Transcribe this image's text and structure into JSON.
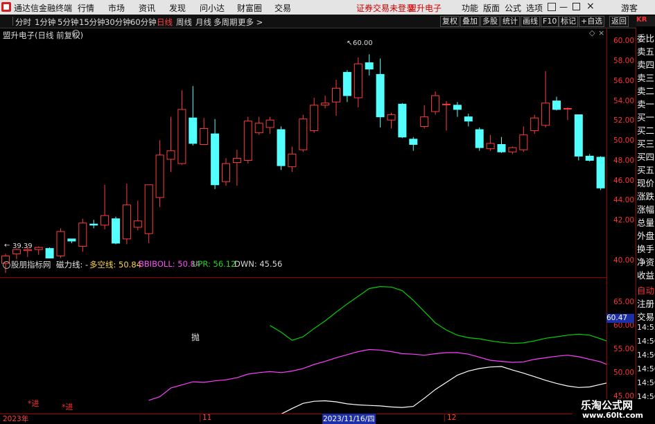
{
  "menu": {
    "app_title": "通达信金融终端",
    "items": [
      "行情",
      "市场",
      "资讯",
      "发现",
      "问小达",
      "财富圈",
      "交易"
    ],
    "notice": "证券交易未登录",
    "stock_name": "盟升电子",
    "right_items": [
      "功能",
      "版面",
      "公式",
      "选项"
    ],
    "guest": "游客"
  },
  "periods": [
    "分时",
    "1分钟",
    "5分钟",
    "15分钟",
    "30分钟",
    "60分钟",
    "日线",
    "周线",
    "月线",
    "多周期",
    "更多 >"
  ],
  "active_period": "日线",
  "toolbar_right": [
    "复权",
    "叠加",
    "多股",
    "统计",
    "画线",
    "F10",
    "标记",
    "+自选",
    "返回"
  ],
  "main_title": "盟升电子(日线 前复权)",
  "chart_data": [
    {
      "type": "candlestick",
      "title": "盟升电子(日线 前复权)",
      "yticks": [
        60,
        58,
        56,
        54,
        52,
        50,
        48,
        46,
        44,
        42,
        40
      ],
      "ytick_labels": [
        "60.00",
        "58.00",
        "56.00",
        "54.00",
        "52.00",
        "50.00",
        "48.00",
        "46.00",
        "44.00",
        "42.00",
        "40.00"
      ],
      "ylim": [
        39.0,
        62.5
      ],
      "annotations": {
        "high": "60.00",
        "low": "39.39"
      },
      "candles": [
        {
          "o": 40.3,
          "h": 41.2,
          "l": 39.4,
          "c": 41.0
        },
        {
          "o": 41.2,
          "h": 41.7,
          "l": 40.7,
          "c": 41.6
        },
        {
          "o": 41.5,
          "h": 41.9,
          "l": 40.9,
          "c": 41.6
        },
        {
          "o": 41.6,
          "h": 41.9,
          "l": 41.1,
          "c": 41.8
        },
        {
          "o": 41.7,
          "h": 41.8,
          "l": 40.8,
          "c": 40.8
        },
        {
          "o": 41.0,
          "h": 43.6,
          "l": 40.8,
          "c": 43.3
        },
        {
          "o": 42.6,
          "h": 42.6,
          "l": 42.2,
          "c": 42.4
        },
        {
          "o": 41.9,
          "h": 44.5,
          "l": 41.4,
          "c": 44.1
        },
        {
          "o": 44.0,
          "h": 44.4,
          "l": 43.6,
          "c": 43.9
        },
        {
          "o": 43.9,
          "h": 47.7,
          "l": 43.5,
          "c": 44.8
        },
        {
          "o": 44.5,
          "h": 44.7,
          "l": 42.1,
          "c": 42.2
        },
        {
          "o": 42.6,
          "h": 47.8,
          "l": 42.1,
          "c": 45.8
        },
        {
          "o": 43.7,
          "h": 46.2,
          "l": 43.4,
          "c": 44.3
        },
        {
          "o": 43.1,
          "h": 47.1,
          "l": 42.2,
          "c": 47.7
        },
        {
          "o": 46.5,
          "h": 51.9,
          "l": 45.6,
          "c": 50.5
        },
        {
          "o": 50.1,
          "h": 54.1,
          "l": 48.9,
          "c": 50.9
        },
        {
          "o": 49.7,
          "h": 56.6,
          "l": 49.6,
          "c": 54.8
        },
        {
          "o": 54.0,
          "h": 57.0,
          "l": 51.4,
          "c": 51.6
        },
        {
          "o": 51.5,
          "h": 54.0,
          "l": 51.5,
          "c": 53.0
        },
        {
          "o": 52.5,
          "h": 53.9,
          "l": 47.3,
          "c": 47.7
        },
        {
          "o": 48.0,
          "h": 50.2,
          "l": 47.6,
          "c": 49.7
        },
        {
          "o": 49.8,
          "h": 51.0,
          "l": 47.6,
          "c": 50.2
        },
        {
          "o": 50.0,
          "h": 54.1,
          "l": 49.7,
          "c": 53.7
        },
        {
          "o": 52.6,
          "h": 54.1,
          "l": 52.4,
          "c": 53.5
        },
        {
          "o": 53.1,
          "h": 54.1,
          "l": 52.5,
          "c": 53.8
        },
        {
          "o": 52.9,
          "h": 53.2,
          "l": 49.1,
          "c": 49.5
        },
        {
          "o": 49.4,
          "h": 51.3,
          "l": 48.9,
          "c": 50.6
        },
        {
          "o": 51.0,
          "h": 54.3,
          "l": 50.8,
          "c": 53.9
        },
        {
          "o": 52.8,
          "h": 55.9,
          "l": 52.6,
          "c": 55.2
        },
        {
          "o": 55.2,
          "h": 56.1,
          "l": 54.9,
          "c": 55.4
        },
        {
          "o": 55.5,
          "h": 57.6,
          "l": 54.2,
          "c": 56.8
        },
        {
          "o": 58.3,
          "h": 58.5,
          "l": 55.5,
          "c": 56.1
        },
        {
          "o": 55.9,
          "h": 59.7,
          "l": 55.0,
          "c": 59.1
        },
        {
          "o": 59.2,
          "h": 60.0,
          "l": 58.0,
          "c": 58.6
        },
        {
          "o": 58.1,
          "h": 59.6,
          "l": 53.1,
          "c": 54.1
        },
        {
          "o": 53.8,
          "h": 54.5,
          "l": 53.0,
          "c": 54.3
        },
        {
          "o": 55.3,
          "h": 55.4,
          "l": 52.1,
          "c": 52.2
        },
        {
          "o": 52.0,
          "h": 52.2,
          "l": 50.9,
          "c": 51.5
        },
        {
          "o": 53.2,
          "h": 55.2,
          "l": 53.0,
          "c": 54.1
        },
        {
          "o": 54.6,
          "h": 56.5,
          "l": 54.3,
          "c": 56.1
        },
        {
          "o": 55.3,
          "h": 55.6,
          "l": 52.8,
          "c": 55.3
        },
        {
          "o": 55.2,
          "h": 55.5,
          "l": 54.1,
          "c": 54.8
        },
        {
          "o": 54.1,
          "h": 54.4,
          "l": 53.2,
          "c": 53.7
        },
        {
          "o": 52.9,
          "h": 53.1,
          "l": 50.9,
          "c": 51.2
        },
        {
          "o": 51.1,
          "h": 52.4,
          "l": 50.9,
          "c": 51.6
        },
        {
          "o": 51.5,
          "h": 52.2,
          "l": 50.7,
          "c": 50.8
        },
        {
          "o": 50.8,
          "h": 51.3,
          "l": 50.6,
          "c": 51.2
        },
        {
          "o": 51.0,
          "h": 53.2,
          "l": 50.8,
          "c": 52.4
        },
        {
          "o": 52.8,
          "h": 54.3,
          "l": 52.5,
          "c": 54.0
        },
        {
          "o": 53.3,
          "h": 58.4,
          "l": 53.1,
          "c": 55.4
        },
        {
          "o": 55.6,
          "h": 56.0,
          "l": 54.7,
          "c": 54.8
        },
        {
          "o": 54.9,
          "h": 55.0,
          "l": 53.8,
          "c": 54.9
        },
        {
          "o": 54.3,
          "h": 54.3,
          "l": 50.0,
          "c": 50.4
        },
        {
          "o": 50.4,
          "h": 50.6,
          "l": 49.9,
          "c": 50.0
        },
        {
          "o": 50.3,
          "h": 50.4,
          "l": 47.2,
          "c": 47.4
        },
        {
          "o": 47.1,
          "h": 47.9,
          "l": 45.8,
          "c": 47.2
        }
      ]
    },
    {
      "type": "line",
      "title": "磁力线",
      "yticks": [
        65,
        60,
        55,
        50,
        45
      ],
      "ytick_labels": [
        "65.00",
        "60.00",
        "55.00",
        "50.00",
        "45.00"
      ],
      "ylim": [
        42.7,
        69.2
      ],
      "series": [
        {
          "name": "多空线",
          "color": "#ffffff",
          "start_index": 24,
          "values": [
            41.7,
            42.6,
            43.7,
            44.7,
            45.1,
            45.2,
            45.0,
            44.6,
            44.4,
            44.3,
            44.2,
            44.0,
            43.9,
            44.1,
            45.7,
            47.4,
            48.8,
            50.2,
            51.0,
            51.5,
            51.8,
            51.9,
            51.2,
            50.6,
            49.9,
            49.2,
            48.6,
            48.1,
            47.8,
            47.9,
            48.4,
            48.9,
            49.3,
            49.7,
            49.9,
            49.6,
            48.5,
            46.2
          ]
        },
        {
          "name": "BBIBOLL",
          "color": "#ff40ff",
          "start_index": 13,
          "values": [
            45.3,
            46.0,
            47.7,
            48.3,
            48.9,
            48.8,
            49.1,
            49.3,
            49.7,
            50.4,
            50.7,
            50.9,
            50.7,
            51.0,
            51.5,
            52.3,
            52.9,
            53.6,
            54.2,
            54.8,
            55.2,
            55.1,
            54.8,
            54.4,
            54.3,
            54.1,
            54.4,
            54.6,
            54.6,
            54.3,
            53.7,
            53.1,
            52.9,
            52.7,
            52.8,
            53.3,
            53.6,
            53.9,
            54.1,
            53.8,
            53.3,
            52.8,
            51.9,
            51.0
          ]
        },
        {
          "name": "UPR",
          "color": "#00d000",
          "start_index": 24,
          "values": [
            59.9,
            58.6,
            57.0,
            57.7,
            59.3,
            60.8,
            62.5,
            64.1,
            65.6,
            67.1,
            67.5,
            67.4,
            66.7,
            64.8,
            62.6,
            60.4,
            59.0,
            58.0,
            57.5,
            57.3,
            56.9,
            56.6,
            56.4,
            56.5,
            56.9,
            57.4,
            57.7,
            58.0,
            58.2,
            58.0,
            57.3,
            56.5,
            55.8,
            55.6,
            56.0,
            56.2
          ]
        }
      ],
      "legend_values": {
        "多空线": "50.84",
        "BBIBOLL": "50.84",
        "UPR": "56.12",
        "DWN": "45.56"
      }
    }
  ],
  "indicator": {
    "name": "股朋指标网",
    "line_label": "磁力线: -",
    "s1": "多空线: 50.84",
    "s2": "BBIBOLL: 50.84",
    "s3": "UPR: 56.12",
    "s4": "DWN: 45.56",
    "cur_value": "60.47",
    "marker_text": "抛",
    "buy_mark": "*进"
  },
  "dates": {
    "d1": "2023年",
    "d2": "11",
    "d3": "2023/11/16/四",
    "d4": "12"
  },
  "right_panel": {
    "items": [
      "委比",
      "卖五",
      "卖四",
      "卖三",
      "卖二",
      "卖一",
      "买一",
      "买二",
      "买三",
      "买四",
      "买五",
      "现价",
      "涨跌",
      "涨幅",
      "总量",
      "外盘",
      "换手",
      "净资",
      "收益"
    ],
    "items2": [
      "自动",
      "注册",
      "交易"
    ],
    "times": [
      "14:55",
      "14:56",
      "14:56",
      "14:56",
      "14:56",
      "14:56"
    ],
    "kr_label": "KR"
  },
  "watermark": {
    "line1": "乐淘公式网",
    "line2": "www.60lt.com"
  }
}
